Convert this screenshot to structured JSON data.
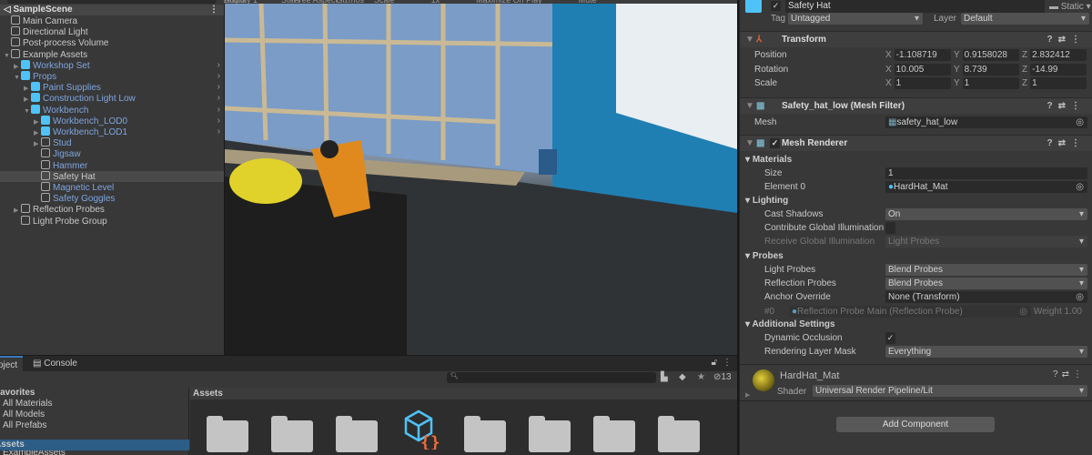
{
  "game_toolbar": [
    "Display 1",
    "Free Aspect",
    "Scale",
    "1x",
    "Maximize On Play",
    "Mute Audio",
    "Stats",
    "Gizmos"
  ],
  "hierarchy": {
    "scene": "SampleScene",
    "items": [
      {
        "label": "Main Camera",
        "depth": 0,
        "prefab": false,
        "arrow": ""
      },
      {
        "label": "Directional Light",
        "depth": 0,
        "prefab": false,
        "arrow": ""
      },
      {
        "label": "Post-process Volume",
        "depth": 0,
        "prefab": false,
        "arrow": ""
      },
      {
        "label": "Example Assets",
        "depth": 0,
        "prefab": false,
        "arrow": "▼"
      },
      {
        "label": "Workshop Set",
        "depth": 1,
        "prefab": true,
        "arrow": "▶",
        "chev": true
      },
      {
        "label": "Props",
        "depth": 1,
        "prefab": true,
        "arrow": "▼",
        "chev": true
      },
      {
        "label": "Paint Supplies",
        "depth": 2,
        "prefab": true,
        "arrow": "▶",
        "chev": true
      },
      {
        "label": "Construction Light Low",
        "depth": 2,
        "prefab": true,
        "arrow": "▶",
        "chev": true
      },
      {
        "label": "Workbench",
        "depth": 2,
        "prefab": true,
        "arrow": "▼",
        "chev": true
      },
      {
        "label": "Workbench_LOD0",
        "depth": 3,
        "prefab": true,
        "arrow": "▶",
        "chev": true
      },
      {
        "label": "Workbench_LOD1",
        "depth": 3,
        "prefab": true,
        "arrow": "▶",
        "chev": true
      },
      {
        "label": "Stud",
        "depth": 3,
        "prefab": false,
        "blue": true,
        "arrow": "▶"
      },
      {
        "label": "Jigsaw",
        "depth": 3,
        "prefab": false,
        "blue": true,
        "arrow": ""
      },
      {
        "label": "Hammer",
        "depth": 3,
        "prefab": false,
        "blue": true,
        "arrow": ""
      },
      {
        "label": "Safety Hat",
        "depth": 3,
        "prefab": false,
        "arrow": "",
        "selected": true
      },
      {
        "label": "Magnetic Level",
        "depth": 3,
        "prefab": false,
        "blue": true,
        "arrow": ""
      },
      {
        "label": "Safety Goggles",
        "depth": 3,
        "prefab": false,
        "blue": true,
        "arrow": ""
      },
      {
        "label": "Reflection Probes",
        "depth": 1,
        "prefab": false,
        "arrow": "▶"
      },
      {
        "label": "Light Probe Group",
        "depth": 1,
        "prefab": false,
        "arrow": ""
      }
    ]
  },
  "inspector": {
    "name": "Safety Hat",
    "static": "Static",
    "tag_label": "Tag",
    "tag": "Untagged",
    "layer_label": "Layer",
    "layer": "Default",
    "transform": {
      "title": "Transform",
      "rows": [
        {
          "label": "Position",
          "x": "-1.108719",
          "y": "0.9158028",
          "z": "2.832412"
        },
        {
          "label": "Rotation",
          "x": "10.005",
          "y": "8.739",
          "z": "-14.99"
        },
        {
          "label": "Scale",
          "x": "1",
          "y": "1",
          "z": "1"
        }
      ]
    },
    "mesh_filter": {
      "title": "Safety_hat_low (Mesh Filter)",
      "mesh_label": "Mesh",
      "mesh": "safety_hat_low"
    },
    "mesh_renderer": {
      "title": "Mesh Renderer",
      "materials": "Materials",
      "size_label": "Size",
      "size": "1",
      "element0_label": "Element 0",
      "element0": "HardHat_Mat",
      "lighting": "Lighting",
      "cast_shadows_label": "Cast Shadows",
      "cast_shadows": "On",
      "contribute_gi_label": "Contribute Global Illumination",
      "contribute_gi": false,
      "receive_gi_label": "Receive Global Illumination",
      "receive_gi": "Light Probes",
      "probes": "Probes",
      "light_probes_label": "Light Probes",
      "light_probes": "Blend Probes",
      "reflection_probes_label": "Reflection Probes",
      "reflection_probes": "Blend Probes",
      "anchor_label": "Anchor Override",
      "anchor": "None (Transform)",
      "probe_index": "#0",
      "probe_name": "Reflection Probe Main (Reflection Probe)",
      "probe_weight": "Weight 1.00",
      "additional": "Additional Settings",
      "dynamic_occlusion_label": "Dynamic Occlusion",
      "dynamic_occlusion": true,
      "rendering_layer_label": "Rendering Layer Mask",
      "rendering_layer": "Everything"
    },
    "material": {
      "name": "HardHat_Mat",
      "shader_label": "Shader",
      "shader": "Universal Render Pipeline/Lit"
    },
    "add_component": "Add Component"
  },
  "project": {
    "tabs": [
      "Project",
      "Console"
    ],
    "hidden_count": "13",
    "favorites": "Favorites",
    "fav_items": [
      "All Materials",
      "All Models",
      "All Prefabs"
    ],
    "assets_root": "Assets",
    "assets_child": "ExampleAssets",
    "breadcrumb": "Assets"
  },
  "colors": {
    "prefab": "#7ea6e0",
    "selection": "#2c5d87",
    "accent": "#4fc3f7"
  }
}
